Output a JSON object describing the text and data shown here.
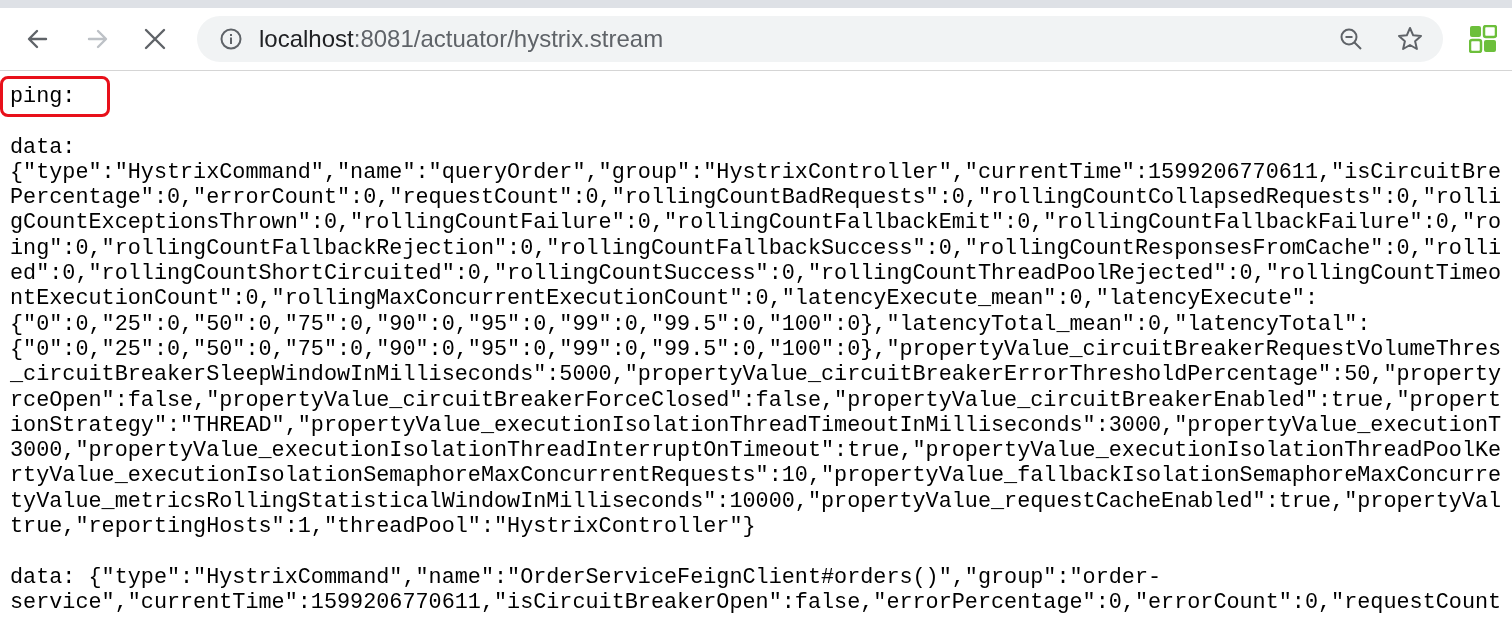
{
  "toolbar": {
    "back_enabled": true,
    "forward_enabled": false,
    "loading": true
  },
  "address_bar": {
    "host": "localhost",
    "rest": ":8081/actuator/hystrix.stream"
  },
  "stream": [
    {
      "highlighted": true,
      "lines": [
        "ping:"
      ]
    },
    {
      "highlighted": false,
      "lines": [
        "data:",
        "{\"type\":\"HystrixCommand\",\"name\":\"queryOrder\",\"group\":\"HystrixController\",\"currentTime\":1599206770611,\"isCircuitBre",
        "Percentage\":0,\"errorCount\":0,\"requestCount\":0,\"rollingCountBadRequests\":0,\"rollingCountCollapsedRequests\":0,\"rolli",
        "gCountExceptionsThrown\":0,\"rollingCountFailure\":0,\"rollingCountFallbackEmit\":0,\"rollingCountFallbackFailure\":0,\"ro",
        "ing\":0,\"rollingCountFallbackRejection\":0,\"rollingCountFallbackSuccess\":0,\"rollingCountResponsesFromCache\":0,\"rolli",
        "ed\":0,\"rollingCountShortCircuited\":0,\"rollingCountSuccess\":0,\"rollingCountThreadPoolRejected\":0,\"rollingCountTimeo",
        "ntExecutionCount\":0,\"rollingMaxConcurrentExecutionCount\":0,\"latencyExecute_mean\":0,\"latencyExecute\":",
        "{\"0\":0,\"25\":0,\"50\":0,\"75\":0,\"90\":0,\"95\":0,\"99\":0,\"99.5\":0,\"100\":0},\"latencyTotal_mean\":0,\"latencyTotal\":",
        "{\"0\":0,\"25\":0,\"50\":0,\"75\":0,\"90\":0,\"95\":0,\"99\":0,\"99.5\":0,\"100\":0},\"propertyValue_circuitBreakerRequestVolumeThres",
        "_circuitBreakerSleepWindowInMilliseconds\":5000,\"propertyValue_circuitBreakerErrorThresholdPercentage\":50,\"property",
        "rceOpen\":false,\"propertyValue_circuitBreakerForceClosed\":false,\"propertyValue_circuitBreakerEnabled\":true,\"propert",
        "ionStrategy\":\"THREAD\",\"propertyValue_executionIsolationThreadTimeoutInMilliseconds\":3000,\"propertyValue_executionT",
        "3000,\"propertyValue_executionIsolationThreadInterruptOnTimeout\":true,\"propertyValue_executionIsolationThreadPoolKe",
        "rtyValue_executionIsolationSemaphoreMaxConcurrentRequests\":10,\"propertyValue_fallbackIsolationSemaphoreMaxConcurre",
        "tyValue_metricsRollingStatisticalWindowInMilliseconds\":10000,\"propertyValue_requestCacheEnabled\":true,\"propertyVal",
        "true,\"reportingHosts\":1,\"threadPool\":\"HystrixController\"}"
      ]
    },
    {
      "highlighted": false,
      "lines": [
        "data: {\"type\":\"HystrixCommand\",\"name\":\"OrderServiceFeignClient#orders()\",\"group\":\"order-",
        "service\",\"currentTime\":1599206770611,\"isCircuitBreakerOpen\":false,\"errorPercentage\":0,\"errorCount\":0,\"requestCount"
      ]
    }
  ]
}
